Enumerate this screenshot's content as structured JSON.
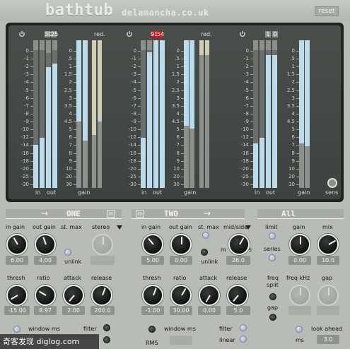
{
  "header": {
    "logo": "bathtub",
    "site": "delamancha.co.uk",
    "reset_label": "reset"
  },
  "meters": {
    "band1": {
      "peak_left": "30",
      "peak_right": "25",
      "in_label": "in",
      "out_label": "out",
      "red_label": "red.",
      "gain_label": "gain"
    },
    "band2": {
      "peak_left": "91",
      "peak_right": "54",
      "in_label": "in",
      "out_label": "out",
      "red_label": "red.",
      "gain_label": "gain"
    },
    "band3": {
      "peak_left": "1",
      "peak_right": "0",
      "in_label": "in",
      "out_label": "out",
      "red_label": "",
      "gain_label": "gain"
    },
    "scale": [
      "0",
      "-1",
      "-2",
      "-3",
      "-4",
      "-5",
      "-6",
      "-7",
      "-8",
      "-9",
      "-10",
      "-12",
      "-14",
      "-16",
      "-18",
      "-20",
      "-25",
      "-30"
    ],
    "scale_gain": [
      "0",
      ".5",
      "1",
      "1.5",
      "2",
      "2.5",
      "3",
      "3.5",
      "4",
      "4.5",
      "5",
      "6",
      "7",
      "8",
      "9",
      "10",
      "20",
      "30"
    ],
    "sens_label": "sens"
  },
  "band_one": {
    "title": "ONE",
    "m_label": "m",
    "in_gain_label": "in gain",
    "in_gain_value": "6.00",
    "out_gain_label": "out gain",
    "out_gain_value": "4.00",
    "st_max_label": "st. max",
    "unlink_label": "unlink",
    "stereo_label": "stereo",
    "thresh_label": "thresh",
    "thresh_value": "-15.00",
    "ratio_label": "ratio",
    "ratio_value": "8.97",
    "attack_label": "attack",
    "attack_value": "2.00",
    "release_label": "release",
    "release_value": "200.0",
    "window_label": "window ms",
    "filter_label": "filter"
  },
  "band_two": {
    "title": "TWO",
    "m_label": "m",
    "in_gain_label": "in gain",
    "in_gain_value": "5.00",
    "out_gain_label": "out gain",
    "out_gain_value": "0.00",
    "st_max_label": "st. max",
    "unlink_label": "unlink",
    "midside_label": "mid/side",
    "m_label2": "m",
    "s_label": "s",
    "midside_value": "26.0",
    "thresh_label": "thresh",
    "thresh_value": "-1.00",
    "ratio_label": "ratio",
    "ratio_value": "30.00",
    "attack_label": "attack",
    "attack_value": "0.00",
    "release_label": "release",
    "release_value": "5.0",
    "window_label": "window ms",
    "rms_label": "RMS",
    "filter_label": "filter",
    "linear_label": "linear"
  },
  "band_all": {
    "title": "All",
    "limit_label": "limit",
    "series_label": "series",
    "gain_label": "gain",
    "gain_value": "0.00",
    "mix_label": "mix",
    "mix_value": "10.0",
    "freq_split_label": "freq\nsplit",
    "freq_split_line1": "freq",
    "freq_split_line2": "split",
    "gap_label": "gap",
    "freq_khz_label": "freq kHz",
    "gap_label2": "gap",
    "look_ahead_label": "look ahead",
    "ms_label": "ms",
    "look_ahead_value": "3.0"
  },
  "watermark": "奇客发现 diglog.com"
}
